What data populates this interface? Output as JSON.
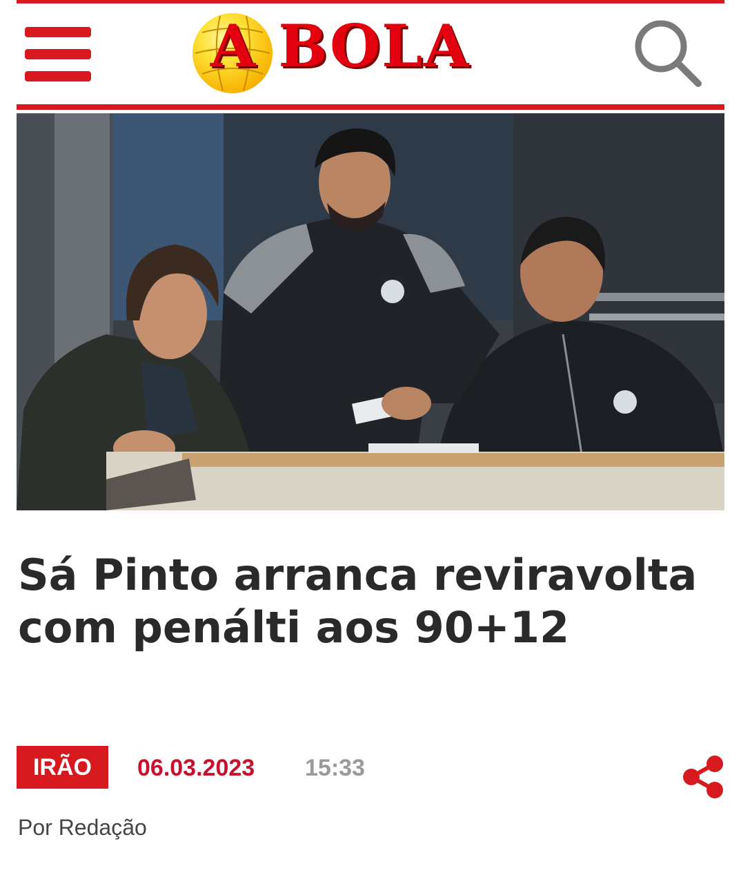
{
  "header": {
    "menu_icon": "hamburger-menu-icon",
    "logo_text": "A BOLA",
    "search_icon": "search-icon"
  },
  "article": {
    "image_description_icon": "hero-photo",
    "headline": "Sá Pinto arranca reviravolta com penálti aos 90+12",
    "category": "IRÃO",
    "date": "06.03.2023",
    "time": "15:33",
    "byline": "Por Redação",
    "share_icon": "share-icon"
  },
  "colors": {
    "brand_red": "#d71920",
    "date_red": "#c8102e",
    "time_gray": "#9a9a9a",
    "headline_text": "#2a2a2a"
  }
}
